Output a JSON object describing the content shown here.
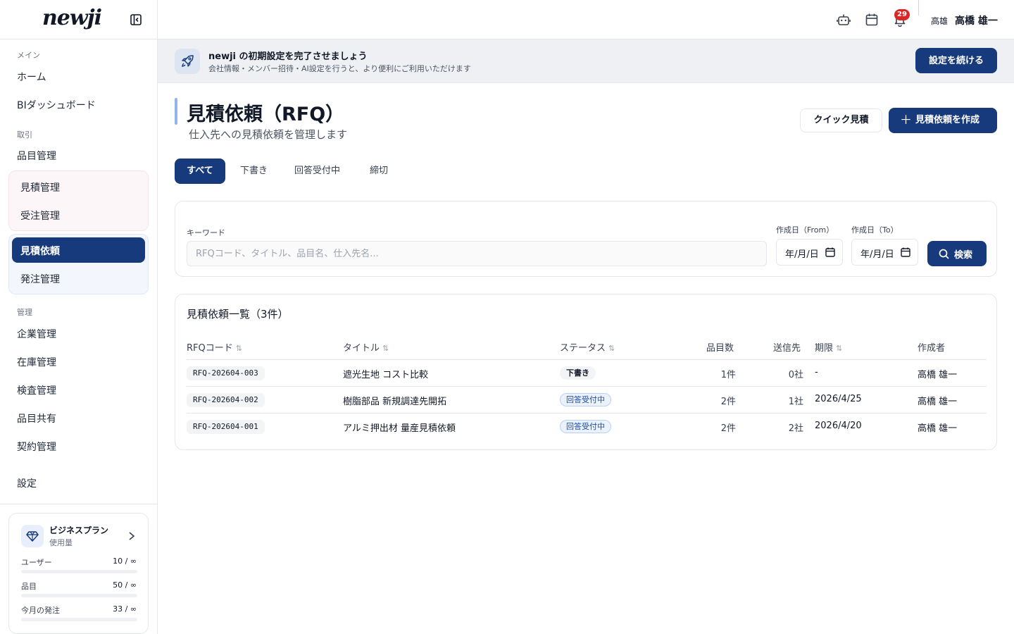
{
  "sidebar": {
    "logo": "newji",
    "sections": {
      "main": "メイン",
      "trade": "取引",
      "manage": "管理"
    },
    "items": {
      "home": "ホーム",
      "bi": "BIダッシュボード",
      "items": "品目管理",
      "estimate": "見積管理",
      "order_recv": "受注管理",
      "rfq": "見積依頼",
      "purchase": "発注管理",
      "company": "企業管理",
      "inventory": "在庫管理",
      "inspection": "検査管理",
      "share": "品目共有",
      "contract": "契約管理",
      "settings": "設定"
    },
    "plan": {
      "title": "ビジネスプラン",
      "subtitle": "使用量",
      "usage": [
        {
          "label": "ユーザー",
          "value": "10 / ∞"
        },
        {
          "label": "品目",
          "value": "50 / ∞"
        },
        {
          "label": "今月の発注",
          "value": "33 / ∞"
        }
      ]
    }
  },
  "topbar": {
    "notification_count": "29",
    "user_short": "高雄",
    "user_name": "高橋 雄一"
  },
  "banner": {
    "title": "newji の初期設定を完了させましょう",
    "subtitle": "会社情報・メンバー招待・AI設定を行うと、より便利にご利用いただけます",
    "button": "設定を続ける"
  },
  "page": {
    "title": "見積依頼（RFQ）",
    "subtitle": "仕入先への見積依頼を管理します",
    "quick_button": "クイック見積",
    "create_button": "見積依頼を作成"
  },
  "tabs": [
    "すべて",
    "下書き",
    "回答受付中",
    "締切"
  ],
  "search": {
    "keyword_label": "キーワード",
    "keyword_placeholder": "RFQコード、タイトル、品目名、仕入先名...",
    "from_label": "作成日（From）",
    "to_label": "作成日（To）",
    "date_placeholder": "年/月/日",
    "button": "検索"
  },
  "table": {
    "title": "見積依頼一覧（3件）",
    "columns": [
      "RFQコード",
      "タイトル",
      "ステータス",
      "品目数",
      "送信先",
      "期限",
      "作成者"
    ],
    "rows": [
      {
        "code": "RFQ-202604-003",
        "title": "遮光生地 コスト比較",
        "status": "下書き",
        "items": "1件",
        "suppliers": "0社",
        "deadline": "-",
        "author": "高橋 雄一"
      },
      {
        "code": "RFQ-202604-002",
        "title": "樹脂部品 新規調達先開拓",
        "status": "回答受付中",
        "items": "2件",
        "suppliers": "1社",
        "deadline": "2026/4/25",
        "author": "高橋 雄一"
      },
      {
        "code": "RFQ-202604-001",
        "title": "アルミ押出材 量産見積依頼",
        "status": "回答受付中",
        "items": "2件",
        "suppliers": "2社",
        "deadline": "2026/4/20",
        "author": "高橋 雄一"
      }
    ]
  },
  "colors": {
    "primary": "#173a7d",
    "badge": "#dc2626",
    "status_wait": "#1d4fa8"
  }
}
